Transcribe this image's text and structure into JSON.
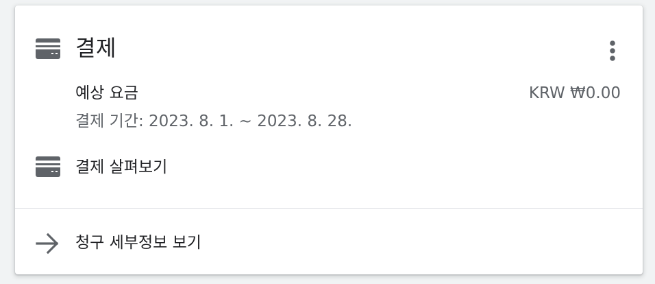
{
  "card": {
    "title": "결제",
    "title_icon": "credit-card-icon",
    "more_icon": "more-vert-icon"
  },
  "estimate": {
    "label": "예상 요금",
    "amount": "KRW ₩0.00",
    "period": "결제 기간: 2023. 8. 1. ~ 2023. 8. 28."
  },
  "review": {
    "label": "결제 살펴보기",
    "icon": "credit-card-icon"
  },
  "footer": {
    "label": "청구 세부정보 보기",
    "icon": "arrow-forward-icon"
  },
  "colors": {
    "icon": "#5f6368",
    "text_primary": "#202124",
    "text_secondary": "#5f6368",
    "divider": "#dadce0"
  }
}
